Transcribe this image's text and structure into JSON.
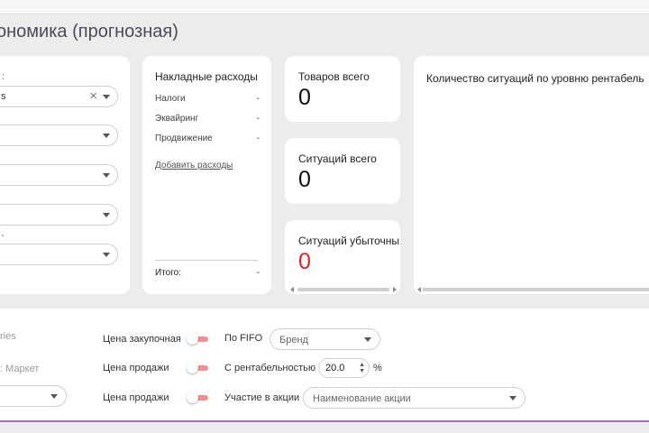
{
  "page": {
    "title": "ономика (прогнозная)"
  },
  "filters": {
    "first_label": ":",
    "first_value": "s",
    "small_mark": "'"
  },
  "overhead": {
    "title": "Накладные расходы",
    "rows": [
      {
        "label": "Налоги",
        "value": "-"
      },
      {
        "label": "Эквайринг",
        "value": "-"
      },
      {
        "label": "Продвижение",
        "value": "-"
      }
    ],
    "add_link": "Добавить расходы",
    "total_label": "Итого:",
    "total_value": "-"
  },
  "stats": [
    {
      "label": "Товаров всего",
      "value": "0"
    },
    {
      "label": "Ситуаций всего",
      "value": "0"
    },
    {
      "label": "Ситуаций убыточны",
      "value": "0"
    }
  ],
  "chart": {
    "title": "Количество ситуаций по уровню рентабель"
  },
  "bottom": {
    "left_label_1": "ries",
    "left_label_2": ": Маркет",
    "toggles": [
      {
        "label": "Цена закупочная"
      },
      {
        "label": "Цена продажи"
      },
      {
        "label": "Цена продажи"
      }
    ],
    "fifo_label": "По FIFO",
    "brand_placeholder": "Бренд",
    "profit_label": "С рентабельностью",
    "profit_value": "20.0",
    "profit_unit": "%",
    "promo_label": "Участие в акции",
    "promo_placeholder": "Наименование акции"
  },
  "colors": {
    "accent_toggle": "#f08f8f",
    "negative": "#d9262b",
    "bottom_line": "#a86bc4"
  }
}
